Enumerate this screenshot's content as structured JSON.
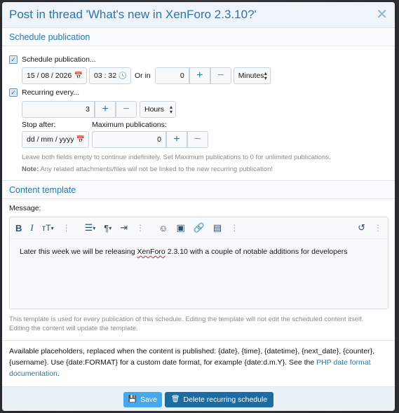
{
  "dialog": {
    "title": "Post in thread 'What's new in XenForo 2.3.10?'",
    "close_icon": "close-icon"
  },
  "schedule": {
    "section_title": "Schedule publication",
    "schedule_label": "Schedule publication...",
    "date_value": "15 / 08 / 2026",
    "time_value": "03 : 32",
    "or_in_label": "Or in",
    "or_in_value": "0",
    "unit_value": "Minutes",
    "recurring_label": "Recurring every...",
    "recurring_value": "3",
    "recurring_unit": "Hours",
    "stop_after_label": "Stop after:",
    "stop_after_placeholder": "dd / mm / yyyy",
    "max_pub_label": "Maximum publications:",
    "max_pub_value": "0",
    "hint": "Leave both fields empty to continue indefinitely. Set Maximum publications to 0 for unlimited publications.",
    "note_label": "Note:",
    "note_text": " Any related attachments/files will not be linked to the new recurring publication!"
  },
  "content": {
    "section_title": "Content template",
    "message_label": "Message:",
    "editor_text_before": "Later this week we will be releasing ",
    "editor_text_misspelled": "XenForo",
    "editor_text_after": " 2.3.10 with a couple of notable additions for developers",
    "template_hint": "This template is used for every publication of this schedule. Editing the template will not edit the scheduled content itself. Editing the content will update the template.",
    "placeholders_text": "Available placeholders, replaced when the content is published: {date}, {time}, {datetime}, {next_date}, {counter}, {username}. Use {date:FORMAT} for a custom date format, for example {date:d.m.Y}. See the ",
    "placeholders_link": "PHP date format documentation",
    "placeholders_end": "."
  },
  "footer": {
    "save_label": "Save",
    "delete_label": "Delete recurring schedule"
  },
  "colors": {
    "accent": "#2577b1",
    "save_button": "#47a7eb",
    "delete_button": "#1c6ba3"
  }
}
